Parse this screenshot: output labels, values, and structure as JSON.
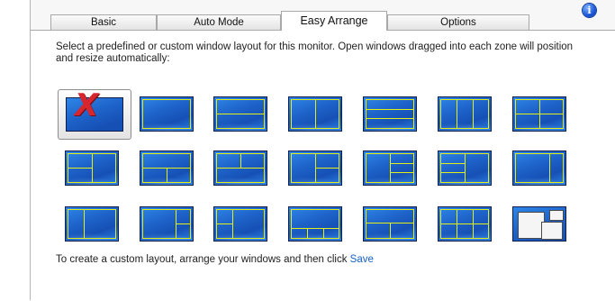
{
  "tabs": [
    {
      "label": "Basic",
      "active": false
    },
    {
      "label": "Auto Mode",
      "active": false
    },
    {
      "label": "Easy Arrange",
      "active": true
    },
    {
      "label": "Options",
      "active": false
    }
  ],
  "info_icon": {
    "glyph": "i",
    "icon": "info-icon"
  },
  "description": "Select a predefined or custom window layout for this monitor. Open windows dragged into each zone will position and resize automatically:",
  "selected_layout_icon": {
    "glyph": "X",
    "icon": "no-layout-icon"
  },
  "footer": {
    "text": "To create a custom layout, arrange your windows and then click",
    "save_link": "Save"
  },
  "colors": {
    "zone_border": "#e2ee1c",
    "thumb_blue": "#1e63c9",
    "accent_link": "#1560c8",
    "x_mark": "#d7262e"
  }
}
